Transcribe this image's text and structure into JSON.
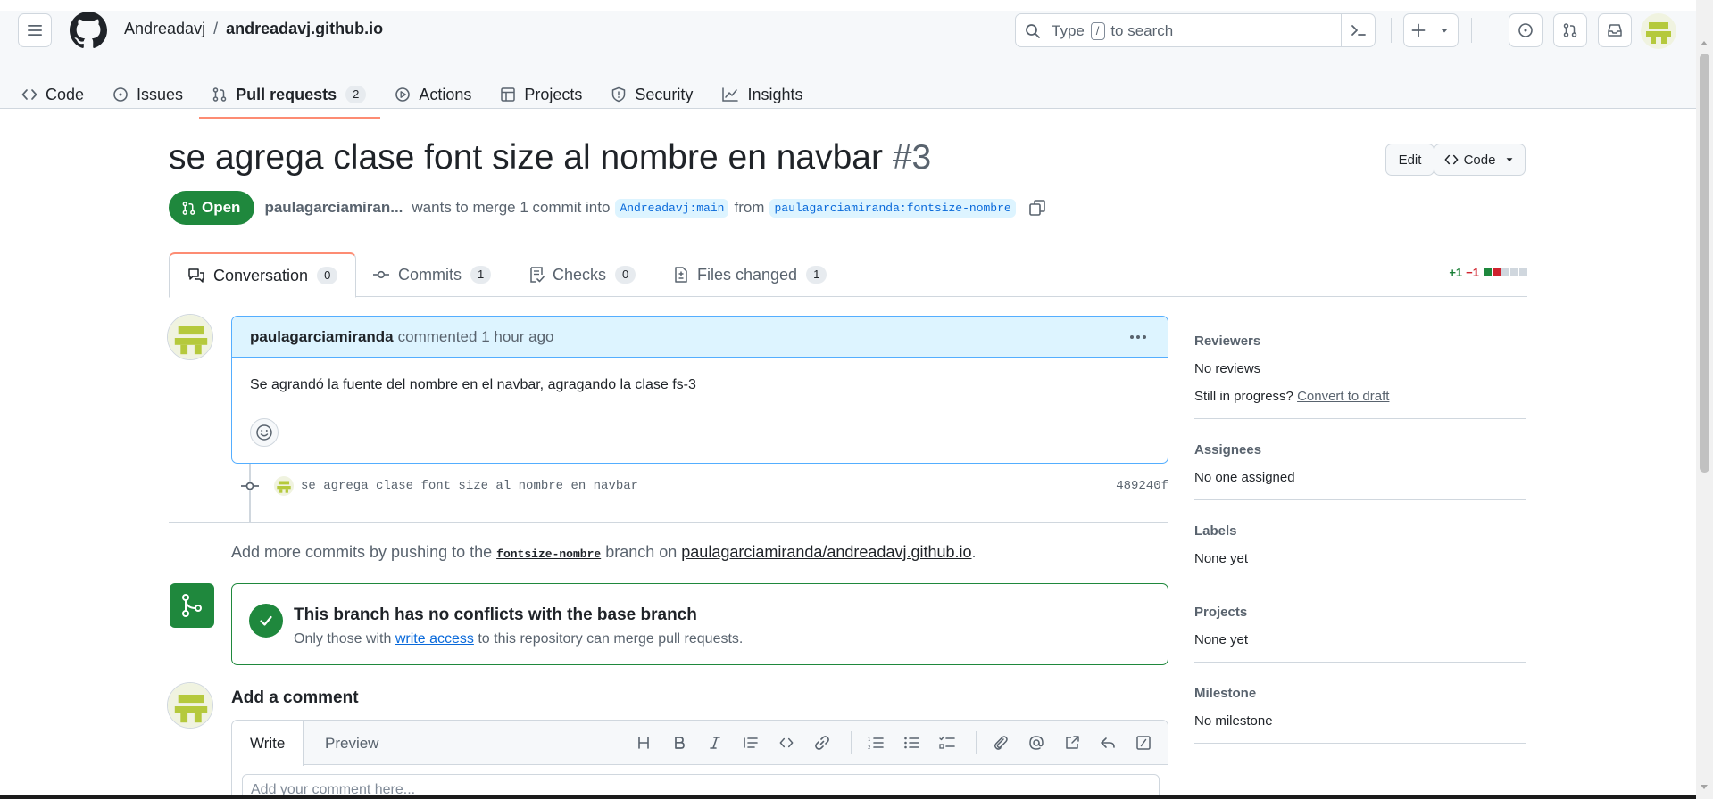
{
  "header": {
    "owner": "Andreadavj",
    "separator": "/",
    "repo": "andreadavj.github.io",
    "search_placeholder_before": "Type",
    "search_placeholder_key": "/",
    "search_placeholder_after": "to search"
  },
  "repo_nav": {
    "items": [
      {
        "label": "Code",
        "icon": "code-icon"
      },
      {
        "label": "Issues",
        "icon": "issue-icon"
      },
      {
        "label": "Pull requests",
        "icon": "pull-request-icon",
        "count": "2",
        "active": true
      },
      {
        "label": "Actions",
        "icon": "play-icon"
      },
      {
        "label": "Projects",
        "icon": "table-icon"
      },
      {
        "label": "Security",
        "icon": "shield-icon"
      },
      {
        "label": "Insights",
        "icon": "graph-icon"
      }
    ]
  },
  "pr": {
    "title": "se agrega clase font size al nombre en navbar",
    "number": "#3",
    "edit_label": "Edit",
    "code_label": "Code",
    "state": "Open",
    "author": "paulagarciamiran...",
    "merge_text": "wants to merge 1 commit into",
    "base_branch": "Andreadavj:main",
    "from_text": "from",
    "head_branch": "paulagarciamiranda:fontsize-nombre"
  },
  "tabs": [
    {
      "label": "Conversation",
      "count": "0",
      "icon": "comment-discussion-icon",
      "active": true
    },
    {
      "label": "Commits",
      "count": "1",
      "icon": "commit-icon"
    },
    {
      "label": "Checks",
      "count": "0",
      "icon": "checklist-icon"
    },
    {
      "label": "Files changed",
      "count": "1",
      "icon": "file-diff-icon"
    }
  ],
  "diffstat": {
    "additions": "+1",
    "deletions": "−1"
  },
  "comment": {
    "author": "paulagarciamiranda",
    "verb": "commented",
    "time": "1 hour ago",
    "body": "Se agrandó la fuente del nombre en el navbar, agragando la clase fs-3"
  },
  "commit": {
    "message": "se agrega clase font size al nombre en navbar",
    "sha": "489240f"
  },
  "push_hint": {
    "before": "Add more commits by pushing to the",
    "branch": "fontsize-nombre",
    "middle": "branch on",
    "repo_link": "paulagarciamiranda/andreadavj.github.io",
    "after": "."
  },
  "merge": {
    "title": "This branch has no conflicts with the base branch",
    "sub_before": "Only those with",
    "sub_link": "write access",
    "sub_after": "to this repository can merge pull requests."
  },
  "add_comment": {
    "title": "Add a comment",
    "write_tab": "Write",
    "preview_tab": "Preview",
    "placeholder": "Add your comment here..."
  },
  "sidebar": {
    "reviewers_heading": "Reviewers",
    "reviewers_value": "No reviews",
    "still_in_progress": "Still in progress?",
    "convert_to_draft": "Convert to draft",
    "assignees_heading": "Assignees",
    "assignees_value": "No one assigned",
    "labels_heading": "Labels",
    "labels_value": "None yet",
    "projects_heading": "Projects",
    "projects_value": "None yet",
    "milestone_heading": "Milestone",
    "milestone_value": "No milestone"
  },
  "colors": {
    "accent_green": "#1f883d",
    "tab_underline": "#fd8c73",
    "link_blue": "#0969da",
    "avatar_green": "#b5c93c"
  }
}
